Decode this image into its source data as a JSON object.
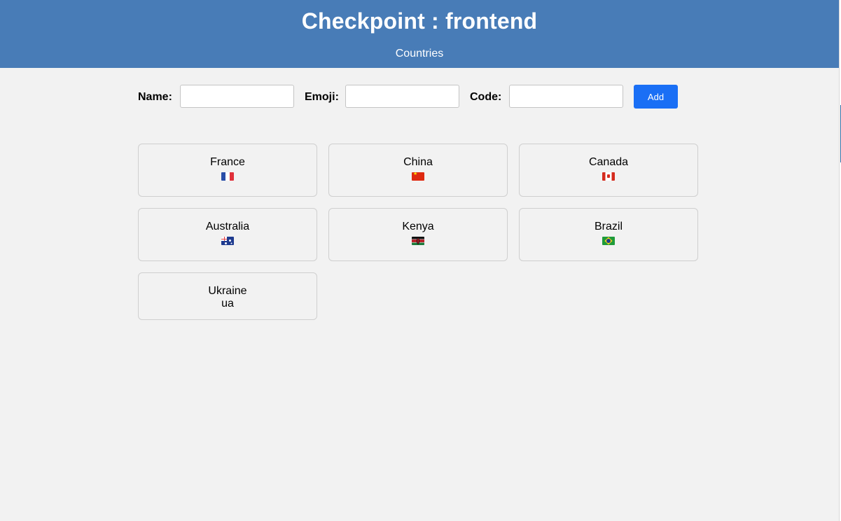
{
  "header": {
    "title": "Checkpoint : frontend",
    "nav_link": "Countries"
  },
  "form": {
    "name_label": "Name:",
    "name_value": "",
    "emoji_label": "Emoji:",
    "emoji_value": "",
    "code_label": "Code:",
    "code_value": "",
    "add_label": "Add"
  },
  "countries": [
    {
      "name": "France",
      "flag_icon": "flag-fr-icon"
    },
    {
      "name": "China",
      "flag_icon": "flag-cn-icon"
    },
    {
      "name": "Canada",
      "flag_icon": "flag-ca-icon"
    },
    {
      "name": "Australia",
      "flag_icon": "flag-au-icon"
    },
    {
      "name": "Kenya",
      "flag_icon": "flag-ke-icon"
    },
    {
      "name": "Brazil",
      "flag_icon": "flag-br-icon"
    },
    {
      "name": "Ukraine",
      "emoji_text": "ua"
    }
  ],
  "colors": {
    "header_bg": "#487cb7",
    "page_bg": "#f2f2f2",
    "button_bg": "#1a6ff5"
  }
}
